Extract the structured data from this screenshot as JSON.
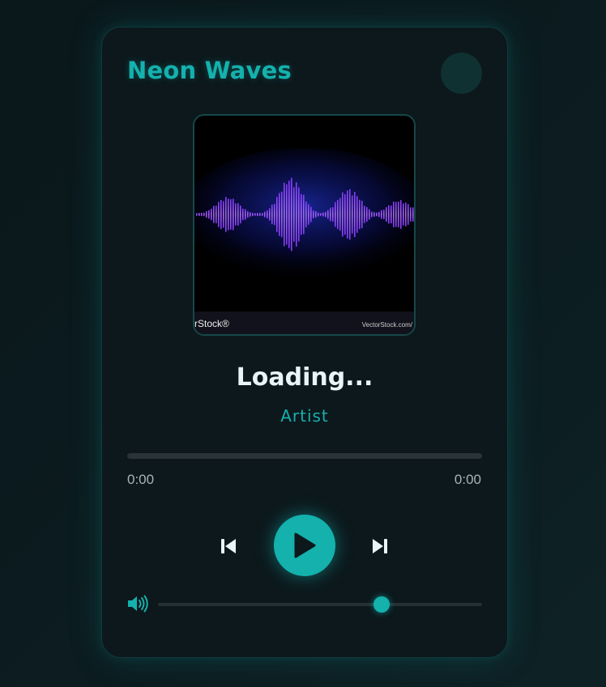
{
  "app": {
    "title": "Neon Waves"
  },
  "album_art": {
    "watermark_left": "rStock®",
    "watermark_right": "VectorStock.com/"
  },
  "track": {
    "title": "Loading...",
    "artist": "Artist"
  },
  "progress": {
    "current": "0:00",
    "duration": "0:00",
    "percent": 0
  },
  "controls": {
    "previous": "previous-icon",
    "play": "play-icon",
    "next": "next-icon",
    "volume_icon": "volume-icon"
  },
  "volume": {
    "percent": 69
  },
  "colors": {
    "accent": "#14b1ad",
    "background": "#0c181c",
    "text_primary": "#e9f4f6",
    "text_muted": "#a6b4b8"
  }
}
